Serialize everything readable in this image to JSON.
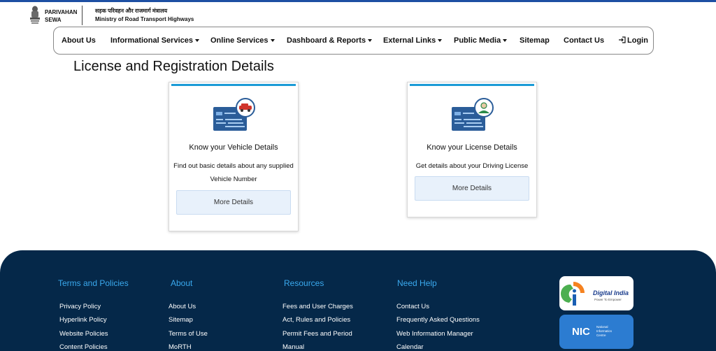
{
  "header": {
    "brand_line1": "PARIVAHAN",
    "brand_line2": "SEWA",
    "ministry_hindi": "सड़क परिवहन और राजमार्ग मंत्रालय",
    "ministry_english": "Ministry of Road Transport Highways"
  },
  "nav": {
    "items": [
      {
        "label": "About Us",
        "dropdown": false
      },
      {
        "label": "Informational Services",
        "dropdown": true
      },
      {
        "label": "Online Services",
        "dropdown": true
      },
      {
        "label": "Dashboard & Reports",
        "dropdown": true
      },
      {
        "label": "External Links",
        "dropdown": true
      },
      {
        "label": "Public Media",
        "dropdown": true
      },
      {
        "label": "Sitemap",
        "dropdown": false
      },
      {
        "label": "Contact Us",
        "dropdown": false
      }
    ],
    "login_label": "Login"
  },
  "main": {
    "title": "License and Registration Details",
    "cards": [
      {
        "title": "Know your Vehicle Details",
        "description": "Find out basic details about any supplied Vehicle Number",
        "button": "More Details"
      },
      {
        "title": "Know your License Details",
        "description": "Get details about your Driving License",
        "button": "More Details"
      }
    ]
  },
  "footer": {
    "columns": [
      {
        "heading": "Terms and Policies",
        "links": [
          "Privacy Policy",
          "Hyperlink Policy",
          "Website Policies",
          "Content Policies"
        ]
      },
      {
        "heading": "About",
        "links": [
          "About Us",
          "Sitemap",
          "Terms of Use",
          "MoRTH"
        ]
      },
      {
        "heading": "Resources",
        "links": [
          "Fees and User Charges",
          "Act, Rules and Policies",
          "Permit Fees and Period",
          "Manual"
        ]
      },
      {
        "heading": "Need Help",
        "links": [
          "Contact Us",
          "Frequently Asked Questions",
          "Web Information Manager",
          "Calendar"
        ]
      }
    ],
    "badges": {
      "digital_india_title": "Digital India",
      "digital_india_tagline": "Power To Empower",
      "nic_title": "NIC",
      "nic_subtitle_1": "National",
      "nic_subtitle_2": "Informatics",
      "nic_subtitle_3": "Centre"
    }
  },
  "colors": {
    "top_accent": "#1d4fa3",
    "footer_bg": "#052849",
    "footer_heading": "#3aa9ee",
    "card_accent": "#1b9bd6",
    "button_bg": "#e8f1fb"
  },
  "icons": [
    "national-emblem-icon",
    "caret-down-icon",
    "login-icon",
    "vehicle-card-icon",
    "license-card-icon",
    "digital-india-logo",
    "nic-logo"
  ]
}
